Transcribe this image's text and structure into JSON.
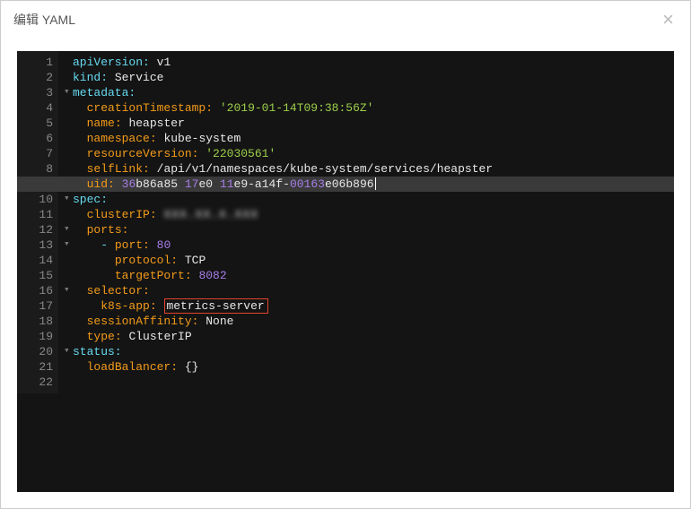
{
  "modal": {
    "title": "编辑 YAML",
    "close": "×"
  },
  "editor": {
    "highlighted_line_index": 8,
    "fold_lines": [
      2,
      9,
      11,
      12,
      15,
      19
    ],
    "lines": [
      [
        {
          "t": "apiVersion:",
          "c": "k-key"
        },
        {
          "t": " "
        },
        {
          "t": "v1",
          "c": "k-val"
        }
      ],
      [
        {
          "t": "kind:",
          "c": "k-key"
        },
        {
          "t": " "
        },
        {
          "t": "Service",
          "c": "k-val"
        }
      ],
      [
        {
          "t": "metadata:",
          "c": "k-key"
        }
      ],
      [
        {
          "t": "  "
        },
        {
          "t": "creationTimestamp:",
          "c": "k-sub"
        },
        {
          "t": " "
        },
        {
          "t": "'2019-01-14T09:38:56Z'",
          "c": "k-str"
        }
      ],
      [
        {
          "t": "  "
        },
        {
          "t": "name:",
          "c": "k-sub"
        },
        {
          "t": " "
        },
        {
          "t": "heapster",
          "c": "k-val"
        }
      ],
      [
        {
          "t": "  "
        },
        {
          "t": "namespace:",
          "c": "k-sub"
        },
        {
          "t": " "
        },
        {
          "t": "kube-system",
          "c": "k-val"
        }
      ],
      [
        {
          "t": "  "
        },
        {
          "t": "resourceVersion:",
          "c": "k-sub"
        },
        {
          "t": " "
        },
        {
          "t": "'22030561'",
          "c": "k-str"
        }
      ],
      [
        {
          "t": "  "
        },
        {
          "t": "selfLink:",
          "c": "k-sub"
        },
        {
          "t": " "
        },
        {
          "t": "/api/v1/namespaces/kube-system/services/heapster",
          "c": "k-val"
        }
      ],
      [
        {
          "t": "  "
        },
        {
          "t": "uid:",
          "c": "k-sub"
        },
        {
          "t": " "
        },
        {
          "t": "36",
          "c": "k-uid1"
        },
        {
          "t": "b86a85",
          "c": "k-uid2"
        },
        {
          "t": "-"
        },
        {
          "t": "17",
          "c": "k-uid1"
        },
        {
          "t": "e0",
          "c": "k-uid2"
        },
        {
          "t": "-"
        },
        {
          "t": "11",
          "c": "k-uid1"
        },
        {
          "t": "e9",
          "c": "k-uid2"
        },
        {
          "t": "-a14f-",
          "c": "k-uid2"
        },
        {
          "t": "00163",
          "c": "k-uid1"
        },
        {
          "t": "e06",
          "c": "k-uid2"
        },
        {
          "t": "b896",
          "c": "k-uid2"
        },
        {
          "cursor": true
        }
      ],
      [
        {
          "t": "spec:",
          "c": "k-key"
        }
      ],
      [
        {
          "t": "  "
        },
        {
          "t": "clusterIP:",
          "c": "k-sub"
        },
        {
          "t": " "
        },
        {
          "t": "XXX.XX.X.XXX",
          "c": "k-val blur"
        }
      ],
      [
        {
          "t": "  "
        },
        {
          "t": "ports:",
          "c": "k-sub"
        }
      ],
      [
        {
          "t": "    "
        },
        {
          "t": "-",
          "c": "k-dash"
        },
        {
          "t": " "
        },
        {
          "t": "port:",
          "c": "k-sub"
        },
        {
          "t": " "
        },
        {
          "t": "80",
          "c": "k-num"
        }
      ],
      [
        {
          "t": "      "
        },
        {
          "t": "protocol:",
          "c": "k-sub"
        },
        {
          "t": " "
        },
        {
          "t": "TCP",
          "c": "k-val"
        }
      ],
      [
        {
          "t": "      "
        },
        {
          "t": "targetPort:",
          "c": "k-sub"
        },
        {
          "t": " "
        },
        {
          "t": "8082",
          "c": "k-num"
        }
      ],
      [
        {
          "t": "  "
        },
        {
          "t": "selector:",
          "c": "k-sub"
        }
      ],
      [
        {
          "t": "    "
        },
        {
          "t": "k8s-app:",
          "c": "k-sub"
        },
        {
          "t": " "
        },
        {
          "t": "metrics-server",
          "c": "k-val boxed"
        }
      ],
      [
        {
          "t": "  "
        },
        {
          "t": "sessionAffinity:",
          "c": "k-sub"
        },
        {
          "t": " "
        },
        {
          "t": "None",
          "c": "k-val"
        }
      ],
      [
        {
          "t": "  "
        },
        {
          "t": "type:",
          "c": "k-sub"
        },
        {
          "t": " "
        },
        {
          "t": "ClusterIP",
          "c": "k-val"
        }
      ],
      [
        {
          "t": "status:",
          "c": "k-key"
        }
      ],
      [
        {
          "t": "  "
        },
        {
          "t": "loadBalancer:",
          "c": "k-sub"
        },
        {
          "t": " {}",
          "c": "k-val"
        }
      ],
      []
    ]
  }
}
